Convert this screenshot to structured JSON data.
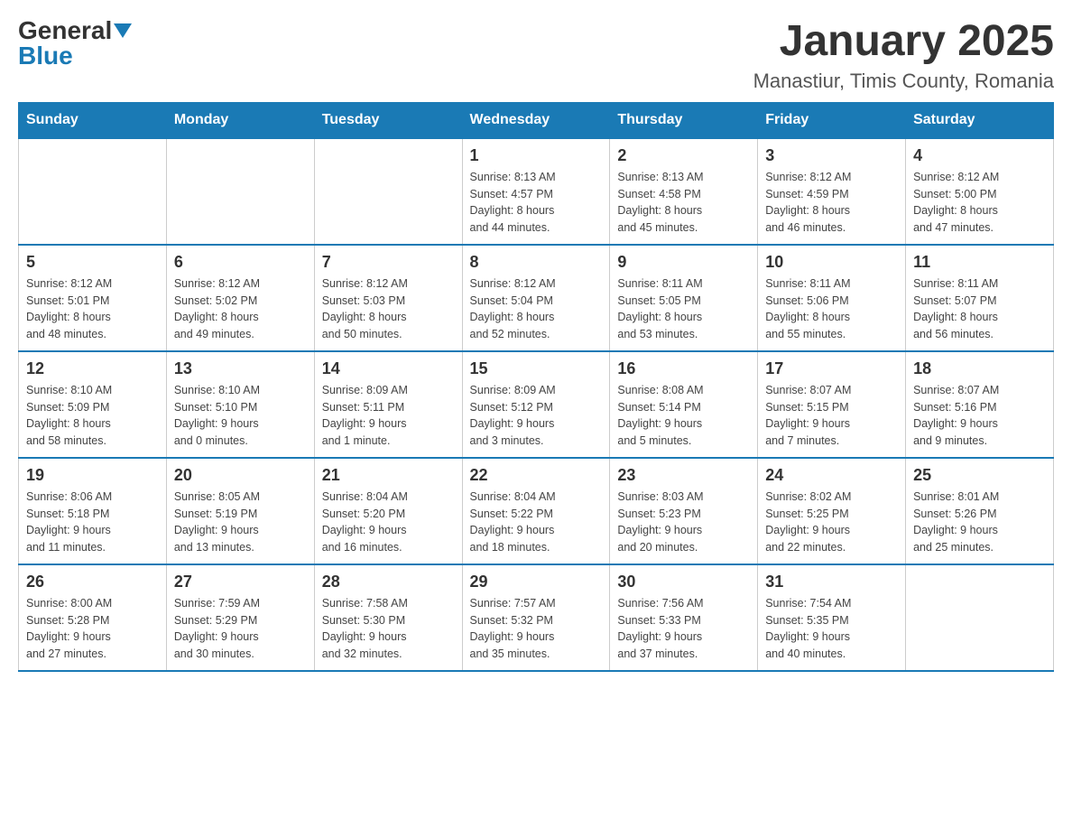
{
  "header": {
    "logo_general": "General",
    "logo_blue": "Blue",
    "month_title": "January 2025",
    "location": "Manastiur, Timis County, Romania"
  },
  "weekdays": [
    "Sunday",
    "Monday",
    "Tuesday",
    "Wednesday",
    "Thursday",
    "Friday",
    "Saturday"
  ],
  "weeks": [
    [
      {
        "day": "",
        "info": ""
      },
      {
        "day": "",
        "info": ""
      },
      {
        "day": "",
        "info": ""
      },
      {
        "day": "1",
        "info": "Sunrise: 8:13 AM\nSunset: 4:57 PM\nDaylight: 8 hours\nand 44 minutes."
      },
      {
        "day": "2",
        "info": "Sunrise: 8:13 AM\nSunset: 4:58 PM\nDaylight: 8 hours\nand 45 minutes."
      },
      {
        "day": "3",
        "info": "Sunrise: 8:12 AM\nSunset: 4:59 PM\nDaylight: 8 hours\nand 46 minutes."
      },
      {
        "day": "4",
        "info": "Sunrise: 8:12 AM\nSunset: 5:00 PM\nDaylight: 8 hours\nand 47 minutes."
      }
    ],
    [
      {
        "day": "5",
        "info": "Sunrise: 8:12 AM\nSunset: 5:01 PM\nDaylight: 8 hours\nand 48 minutes."
      },
      {
        "day": "6",
        "info": "Sunrise: 8:12 AM\nSunset: 5:02 PM\nDaylight: 8 hours\nand 49 minutes."
      },
      {
        "day": "7",
        "info": "Sunrise: 8:12 AM\nSunset: 5:03 PM\nDaylight: 8 hours\nand 50 minutes."
      },
      {
        "day": "8",
        "info": "Sunrise: 8:12 AM\nSunset: 5:04 PM\nDaylight: 8 hours\nand 52 minutes."
      },
      {
        "day": "9",
        "info": "Sunrise: 8:11 AM\nSunset: 5:05 PM\nDaylight: 8 hours\nand 53 minutes."
      },
      {
        "day": "10",
        "info": "Sunrise: 8:11 AM\nSunset: 5:06 PM\nDaylight: 8 hours\nand 55 minutes."
      },
      {
        "day": "11",
        "info": "Sunrise: 8:11 AM\nSunset: 5:07 PM\nDaylight: 8 hours\nand 56 minutes."
      }
    ],
    [
      {
        "day": "12",
        "info": "Sunrise: 8:10 AM\nSunset: 5:09 PM\nDaylight: 8 hours\nand 58 minutes."
      },
      {
        "day": "13",
        "info": "Sunrise: 8:10 AM\nSunset: 5:10 PM\nDaylight: 9 hours\nand 0 minutes."
      },
      {
        "day": "14",
        "info": "Sunrise: 8:09 AM\nSunset: 5:11 PM\nDaylight: 9 hours\nand 1 minute."
      },
      {
        "day": "15",
        "info": "Sunrise: 8:09 AM\nSunset: 5:12 PM\nDaylight: 9 hours\nand 3 minutes."
      },
      {
        "day": "16",
        "info": "Sunrise: 8:08 AM\nSunset: 5:14 PM\nDaylight: 9 hours\nand 5 minutes."
      },
      {
        "day": "17",
        "info": "Sunrise: 8:07 AM\nSunset: 5:15 PM\nDaylight: 9 hours\nand 7 minutes."
      },
      {
        "day": "18",
        "info": "Sunrise: 8:07 AM\nSunset: 5:16 PM\nDaylight: 9 hours\nand 9 minutes."
      }
    ],
    [
      {
        "day": "19",
        "info": "Sunrise: 8:06 AM\nSunset: 5:18 PM\nDaylight: 9 hours\nand 11 minutes."
      },
      {
        "day": "20",
        "info": "Sunrise: 8:05 AM\nSunset: 5:19 PM\nDaylight: 9 hours\nand 13 minutes."
      },
      {
        "day": "21",
        "info": "Sunrise: 8:04 AM\nSunset: 5:20 PM\nDaylight: 9 hours\nand 16 minutes."
      },
      {
        "day": "22",
        "info": "Sunrise: 8:04 AM\nSunset: 5:22 PM\nDaylight: 9 hours\nand 18 minutes."
      },
      {
        "day": "23",
        "info": "Sunrise: 8:03 AM\nSunset: 5:23 PM\nDaylight: 9 hours\nand 20 minutes."
      },
      {
        "day": "24",
        "info": "Sunrise: 8:02 AM\nSunset: 5:25 PM\nDaylight: 9 hours\nand 22 minutes."
      },
      {
        "day": "25",
        "info": "Sunrise: 8:01 AM\nSunset: 5:26 PM\nDaylight: 9 hours\nand 25 minutes."
      }
    ],
    [
      {
        "day": "26",
        "info": "Sunrise: 8:00 AM\nSunset: 5:28 PM\nDaylight: 9 hours\nand 27 minutes."
      },
      {
        "day": "27",
        "info": "Sunrise: 7:59 AM\nSunset: 5:29 PM\nDaylight: 9 hours\nand 30 minutes."
      },
      {
        "day": "28",
        "info": "Sunrise: 7:58 AM\nSunset: 5:30 PM\nDaylight: 9 hours\nand 32 minutes."
      },
      {
        "day": "29",
        "info": "Sunrise: 7:57 AM\nSunset: 5:32 PM\nDaylight: 9 hours\nand 35 minutes."
      },
      {
        "day": "30",
        "info": "Sunrise: 7:56 AM\nSunset: 5:33 PM\nDaylight: 9 hours\nand 37 minutes."
      },
      {
        "day": "31",
        "info": "Sunrise: 7:54 AM\nSunset: 5:35 PM\nDaylight: 9 hours\nand 40 minutes."
      },
      {
        "day": "",
        "info": ""
      }
    ]
  ]
}
